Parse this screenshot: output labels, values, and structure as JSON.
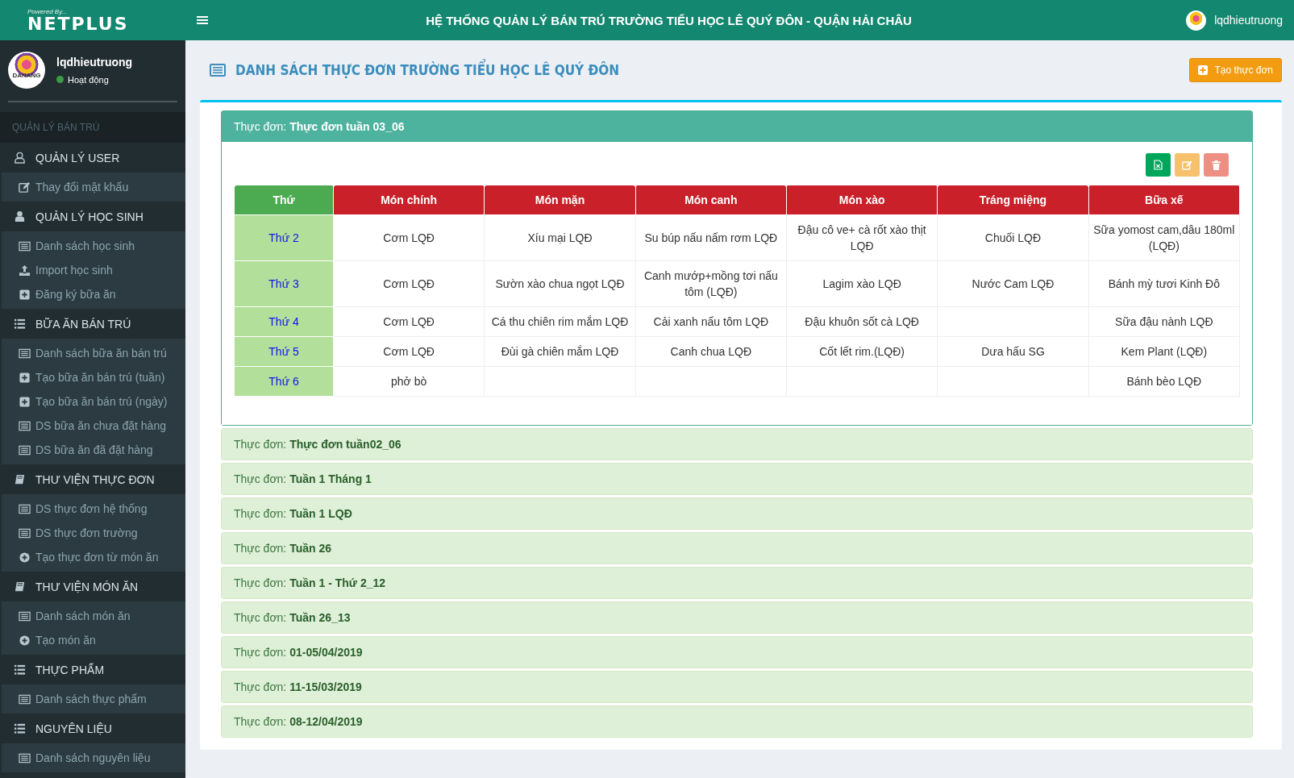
{
  "topbar": {
    "logo_caption": "Powered By...",
    "logo_text": "NETPLUS",
    "title": "HỆ THỐNG QUẢN LÝ BÁN TRÚ TRƯỜNG TIỂU HỌC LÊ QUÝ ĐÔN - QUẬN HẢI CHÂU",
    "user": "lqdhieutruong"
  },
  "sidebar": {
    "profile": {
      "name": "lqdhieutruong",
      "status": "Hoạt động",
      "online": true,
      "avatar_text": "DANANG"
    },
    "section": "QUẢN LÝ BÁN TRÚ",
    "groups": [
      {
        "label": "QUẢN LÝ USER",
        "kind": "user-outline",
        "items": [
          {
            "label": "Thay đổi mật khẩu",
            "kind": "edit"
          }
        ]
      },
      {
        "label": "QUẢN LÝ HỌC SINH",
        "kind": "user",
        "items": [
          {
            "label": "Danh sách học sinh",
            "kind": "list"
          },
          {
            "label": "Import học sinh",
            "kind": "upload"
          },
          {
            "label": "Đăng ký bữa ăn",
            "kind": "add"
          }
        ]
      },
      {
        "label": "BỮA ĂN BÁN TRÚ",
        "kind": "bullets",
        "items": [
          {
            "label": "Danh sách bữa ăn bán trú",
            "kind": "list"
          },
          {
            "label": "Tạo bữa ăn bán trú (tuần)",
            "kind": "add"
          },
          {
            "label": "Tạo bữa ăn bán trú (ngày)",
            "kind": "add"
          },
          {
            "label": "DS bữa ăn chưa đặt hàng",
            "kind": "list"
          },
          {
            "label": "DS bữa ăn đã đặt hàng",
            "kind": "list"
          }
        ]
      },
      {
        "label": "THƯ VIỆN THỰC ĐƠN",
        "kind": "book",
        "items": [
          {
            "label": "DS thực đơn hệ thống",
            "kind": "list"
          },
          {
            "label": "DS thực đơn trường",
            "kind": "list"
          },
          {
            "label": "Tạo thực đơn từ món ăn",
            "kind": "create"
          }
        ]
      },
      {
        "label": "THƯ VIỆN MÓN ĂN",
        "kind": "book",
        "items": [
          {
            "label": "Danh sách món ăn",
            "kind": "list"
          },
          {
            "label": "Tạo món ăn",
            "kind": "create"
          }
        ]
      },
      {
        "label": "THỰC PHẨM",
        "kind": "bullets",
        "items": [
          {
            "label": "Danh sách thực phẩm",
            "kind": "list"
          }
        ]
      },
      {
        "label": "NGUYÊN LIỆU",
        "kind": "bullets",
        "items": [
          {
            "label": "Danh sách nguyên liệu",
            "kind": "list"
          }
        ]
      }
    ]
  },
  "page": {
    "title": "DANH SÁCH THỰC ĐƠN TRƯỜNG TIỂU HỌC LÊ QUÝ ĐÔN",
    "create_button": "Tạo thực đơn"
  },
  "menus": [
    {
      "prefix": "Thực đơn:",
      "name": "Thực đơn tuần 03_06",
      "expanded": true,
      "actions": [
        {
          "kind": "excel"
        },
        {
          "kind": "edit"
        },
        {
          "kind": "delete"
        }
      ],
      "table": {
        "columns": [
          {
            "label": "Thứ",
            "kind": "day"
          },
          {
            "label": "Món chính",
            "kind": "dish"
          },
          {
            "label": "Món mặn",
            "kind": "dish"
          },
          {
            "label": "Món canh",
            "kind": "dish"
          },
          {
            "label": "Món xào",
            "kind": "dish"
          },
          {
            "label": "Tráng miệng",
            "kind": "dish"
          },
          {
            "label": "Bữa xế",
            "kind": "dish"
          }
        ],
        "rows": [
          {
            "cells": [
              "Thứ 2",
              "Cơm LQĐ",
              "Xíu mại LQĐ",
              "Su búp nấu nấm rơm LQĐ",
              "Đậu cô ve+ cà rốt xào thịt LQĐ",
              "Chuối LQĐ",
              "Sữa yomost cam,dâu 180ml (LQĐ)"
            ]
          },
          {
            "cells": [
              "Thứ 3",
              "Cơm LQĐ",
              "Sườn xào chua ngọt LQĐ",
              "Canh mướp+mồng tơi nấu tôm (LQĐ)",
              "Lagim xào LQĐ",
              "Nước Cam LQĐ",
              "Bánh mỳ tươi Kinh Đô"
            ]
          },
          {
            "cells": [
              "Thứ 4",
              "Cơm LQĐ",
              "Cá thu chiên rim mắm LQĐ",
              "Cải xanh nấu tôm LQĐ",
              "Đậu khuôn sốt cà LQĐ",
              "",
              "Sữa đậu nành LQĐ"
            ]
          },
          {
            "cells": [
              "Thứ 5",
              "Cơm LQĐ",
              "Đùi gà chiên mắm LQĐ",
              "Canh chua LQĐ",
              "Cốt lết rim.(LQĐ)",
              "Dưa hấu SG",
              "Kem Plant (LQĐ)"
            ]
          },
          {
            "cells": [
              "Thứ 6",
              "phở bò",
              "",
              "",
              "",
              "",
              "Bánh bèo LQĐ"
            ]
          }
        ]
      }
    },
    {
      "prefix": "Thực đơn:",
      "name": "Thực đơn tuần02_06",
      "expanded": false
    },
    {
      "prefix": "Thực đơn:",
      "name": "Tuần 1 Tháng 1",
      "expanded": false
    },
    {
      "prefix": "Thực đơn:",
      "name": "Tuần 1 LQĐ",
      "expanded": false
    },
    {
      "prefix": "Thực đơn:",
      "name": "Tuần 26",
      "expanded": false
    },
    {
      "prefix": "Thực đơn:",
      "name": "Tuần 1 - Thứ 2_12",
      "expanded": false
    },
    {
      "prefix": "Thực đơn:",
      "name": "Tuần 26_13",
      "expanded": false
    },
    {
      "prefix": "Thực đơn:",
      "name": "01-05/04/2019",
      "expanded": false
    },
    {
      "prefix": "Thực đơn:",
      "name": "11-15/03/2019",
      "expanded": false
    },
    {
      "prefix": "Thực đơn:",
      "name": "08-12/04/2019",
      "expanded": false
    }
  ]
}
